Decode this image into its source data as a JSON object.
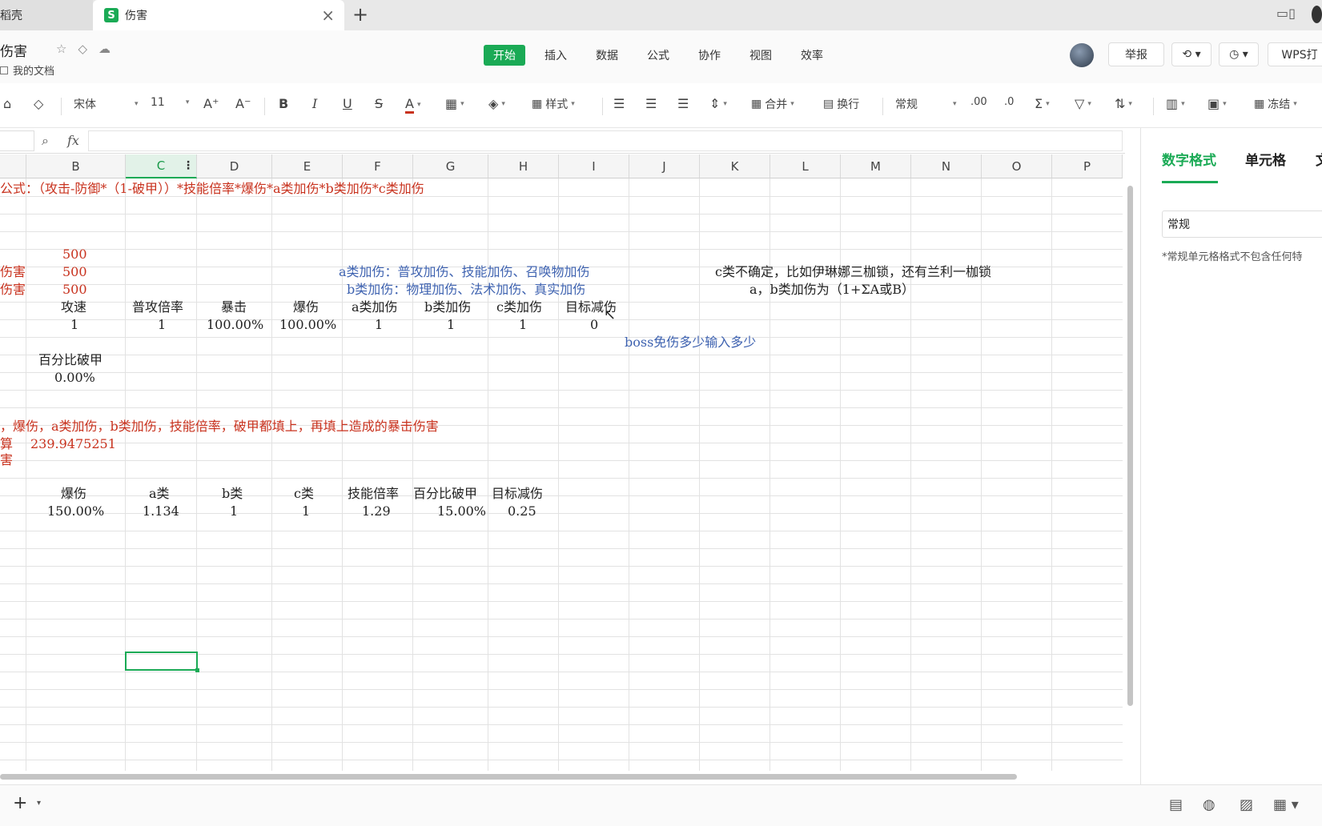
{
  "tabs": {
    "prev": "稻壳",
    "active": "伤害",
    "add": "+"
  },
  "doc": {
    "title": "伤害",
    "location": "我的文档"
  },
  "menu": [
    "开始",
    "插入",
    "数据",
    "公式",
    "协作",
    "视图",
    "效率"
  ],
  "header_right": {
    "report": "举报",
    "wps": "WPS打"
  },
  "toolbar": {
    "font": "宋体",
    "size": "11",
    "bold": "B",
    "italic": "I",
    "underline": "U",
    "strike": "S",
    "font_color": "A",
    "style": "样式",
    "merge": "合并",
    "wrap": "换行",
    "format": "常规",
    "freeze": "冻结",
    "increase_font": "A⁺",
    "decrease_font": "A⁻"
  },
  "formula": {
    "fx": "fx",
    "value": ""
  },
  "columns": [
    {
      "id": "col-b",
      "label": "B"
    },
    {
      "id": "col-c",
      "label": "C"
    },
    {
      "id": "col-d",
      "label": "D"
    },
    {
      "id": "col-e",
      "label": "E"
    },
    {
      "id": "col-f",
      "label": "F"
    },
    {
      "id": "col-g",
      "label": "G"
    },
    {
      "id": "col-h",
      "label": "H"
    },
    {
      "id": "col-i",
      "label": "I"
    },
    {
      "id": "col-j",
      "label": "J"
    },
    {
      "id": "col-k",
      "label": "K"
    },
    {
      "id": "col-l",
      "label": "L"
    },
    {
      "id": "col-m",
      "label": "M"
    },
    {
      "id": "col-n",
      "label": "N"
    },
    {
      "id": "col-o",
      "label": "O"
    },
    {
      "id": "col-p",
      "label": "P"
    }
  ],
  "sheet": {
    "formula_note": "公式：（攻击-防御*（1-破甲））*技能倍率*爆伤*a类加伤*b类加伤*c类加伤",
    "v500_1": "500",
    "v500_2": "500",
    "v500_3": "500",
    "left_a": "伤害",
    "left_b": "伤害",
    "note_a": "a类加伤：普攻加伤、技能加伤、召唤物加伤",
    "note_b": "b类加伤：物理加伤、法术加伤、真实加伤",
    "note_c": "c类不确定，比如伊琳娜三枷锁，还有兰利一枷锁",
    "note_ab": "a，b类加伤为（1+ΣA或B）",
    "h1": [
      "攻速",
      "普攻倍率",
      "暴击",
      "爆伤",
      "a类加伤",
      "b类加伤",
      "c类加伤",
      "目标减伤"
    ],
    "r1": [
      "1",
      "1",
      "100.00%",
      "100.00%",
      "1",
      "1",
      "1",
      "0"
    ],
    "boss_note": "boss免伤多少输入多少",
    "armor_label": "百分比破甲",
    "armor_value": "0.00%",
    "instruction": "，爆伤，a类加伤，b类加伤，技能倍率，破甲都填上，再填上造成的暴击伤害",
    "calc_label": "算",
    "calc_value": "239.9475251",
    "left_c": "害",
    "h2": [
      "爆伤",
      "a类",
      "b类",
      "c类",
      "技能倍率",
      "百分比破甲",
      "目标减伤"
    ],
    "r2": [
      "150.00%",
      "1.134",
      "1",
      "1",
      "1.29",
      "15.00%",
      "0.25"
    ]
  },
  "panel": {
    "tab1": "数字格式",
    "tab2": "单元格",
    "tab3": "文",
    "format_value": "常规",
    "note": "*常规单元格格式不包含任何特"
  },
  "colors": {
    "accent": "#1aaa55",
    "red_text": "#c8321e",
    "blue_text": "#3e62b0"
  }
}
